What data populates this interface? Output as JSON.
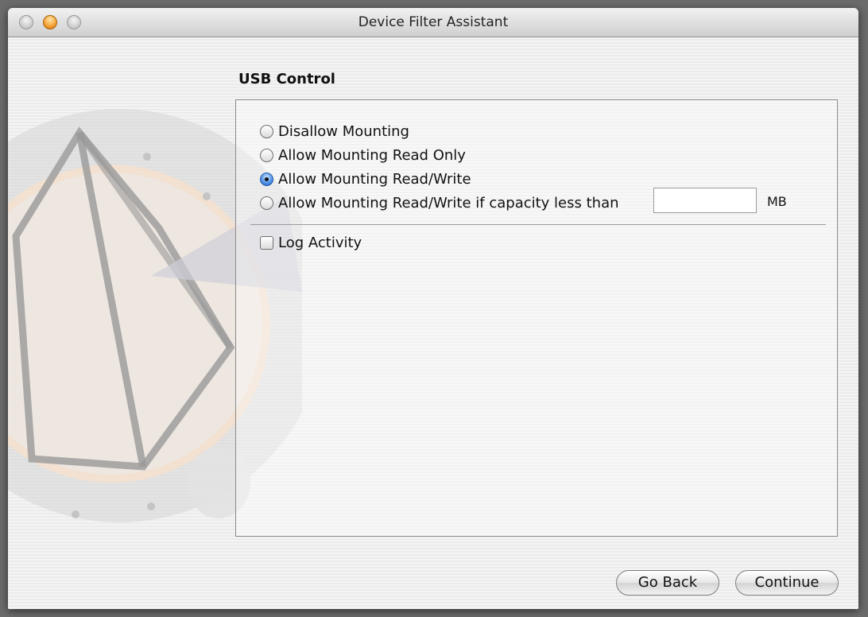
{
  "window": {
    "title": "Device Filter Assistant"
  },
  "section": {
    "title": "USB Control"
  },
  "options": [
    {
      "label": "Disallow Mounting",
      "selected": false
    },
    {
      "label": "Allow Mounting Read Only",
      "selected": false
    },
    {
      "label": "Allow Mounting Read/Write",
      "selected": true
    },
    {
      "label": "Allow Mounting Read/Write if capacity less than",
      "selected": false
    }
  ],
  "capacity": {
    "value": "",
    "unit": "MB"
  },
  "log_activity": {
    "label": "Log Activity",
    "checked": false
  },
  "buttons": {
    "back": "Go Back",
    "continue": "Continue"
  },
  "colors": {
    "accent": "#4a8ee6",
    "art_orange": "#f2c9a4"
  }
}
